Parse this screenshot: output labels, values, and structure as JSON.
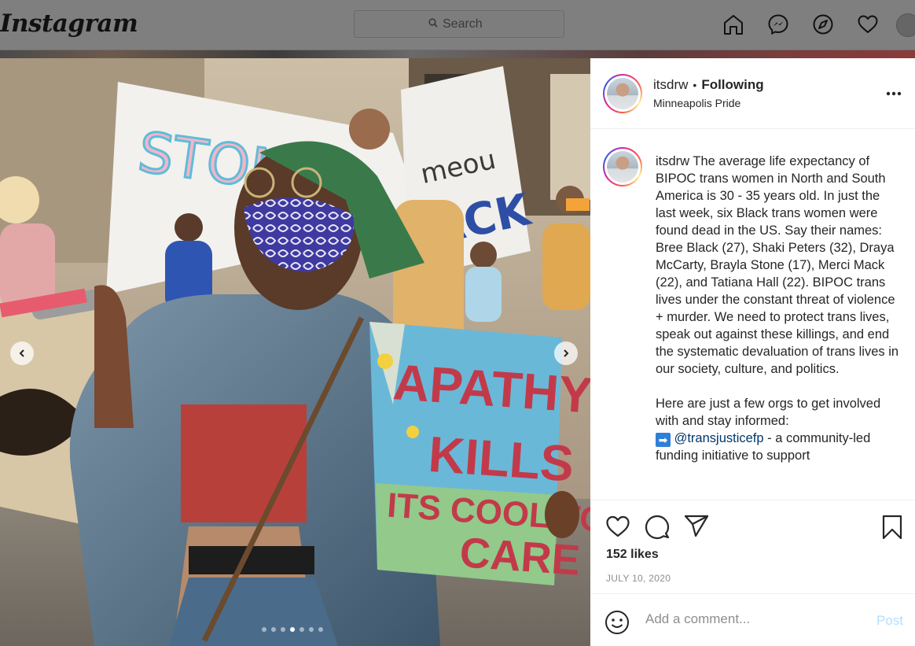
{
  "topnav": {
    "logo": "Instagram",
    "search_placeholder": "Search",
    "icons": [
      "home-icon",
      "messenger-icon",
      "explore-icon",
      "heart-icon",
      "profile-avatar"
    ]
  },
  "post": {
    "username": "itsdrw",
    "follow_status": "Following",
    "location": "Minneapolis Pride",
    "caption_text_1": " The average life expectancy of BIPOC trans women in North and South America is 30 - 35 years old. In just the last week, six Black trans women were found dead in the US. Say their names: Bree Black (27), Shaki Peters (32), Draya McCarty, Brayla Stone (17), Merci Mack (22), and Tatiana Hall (22). BIPOC trans lives under the constant threat of violence + murder. We need to protect trans lives, speak out against these killings, and end the systematic devaluation of trans lives in our society, culture, and politics.\n\nHere are just a few orgs to get involved with and stay informed:\n",
    "caption_arrow": "➡",
    "caption_mention": "@transjusticefp",
    "caption_text_2": " - a community-led funding initiative to support",
    "likes": "152 likes",
    "date": "JULY 10, 2020",
    "comment_placeholder": "Add a comment...",
    "post_button": "Post",
    "carousel": {
      "count": 7,
      "active_index": 3
    },
    "sign_text": [
      "APATHY",
      "KILLS",
      "ITS COOL TO",
      "CARE"
    ]
  },
  "colors": {
    "overlay": "#7f7f7f",
    "mention": "#00376b",
    "post_button": "#b2dffc",
    "muted": "#8e8e8e"
  }
}
